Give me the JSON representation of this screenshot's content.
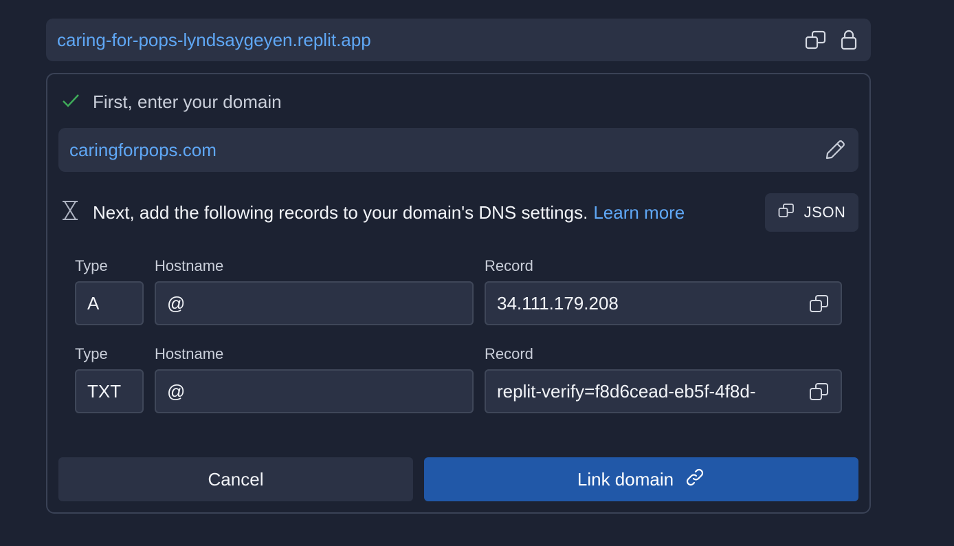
{
  "app_url": {
    "text": "caring-for-pops-lyndsaygeyen.replit.app",
    "icons": [
      "copy-icon",
      "lock-icon"
    ]
  },
  "step_domain": {
    "label": "First, enter your domain",
    "status_icon": "check-icon",
    "domain_value": "caringforpops.com",
    "edit_icon": "pencil-icon"
  },
  "step_records": {
    "label": "Next, add the following records to your domain's DNS settings.",
    "learn_more": "Learn more",
    "status_icon": "hourglass-icon",
    "json_button": "JSON"
  },
  "records": [
    {
      "type_label": "Type",
      "hostname_label": "Hostname",
      "record_label": "Record",
      "type": "A",
      "hostname": "@",
      "record": "34.111.179.208"
    },
    {
      "type_label": "Type",
      "hostname_label": "Hostname",
      "record_label": "Record",
      "type": "TXT",
      "hostname": "@",
      "record": "replit-verify=f8d6cead-eb5f-4f8d-"
    }
  ],
  "actions": {
    "cancel": "Cancel",
    "link_domain": "Link domain"
  },
  "colors": {
    "background": "#1c2232",
    "surface": "#2b3245",
    "accent_link": "#5fa7f5",
    "primary_button": "#2158a8",
    "success": "#3fae5a"
  }
}
